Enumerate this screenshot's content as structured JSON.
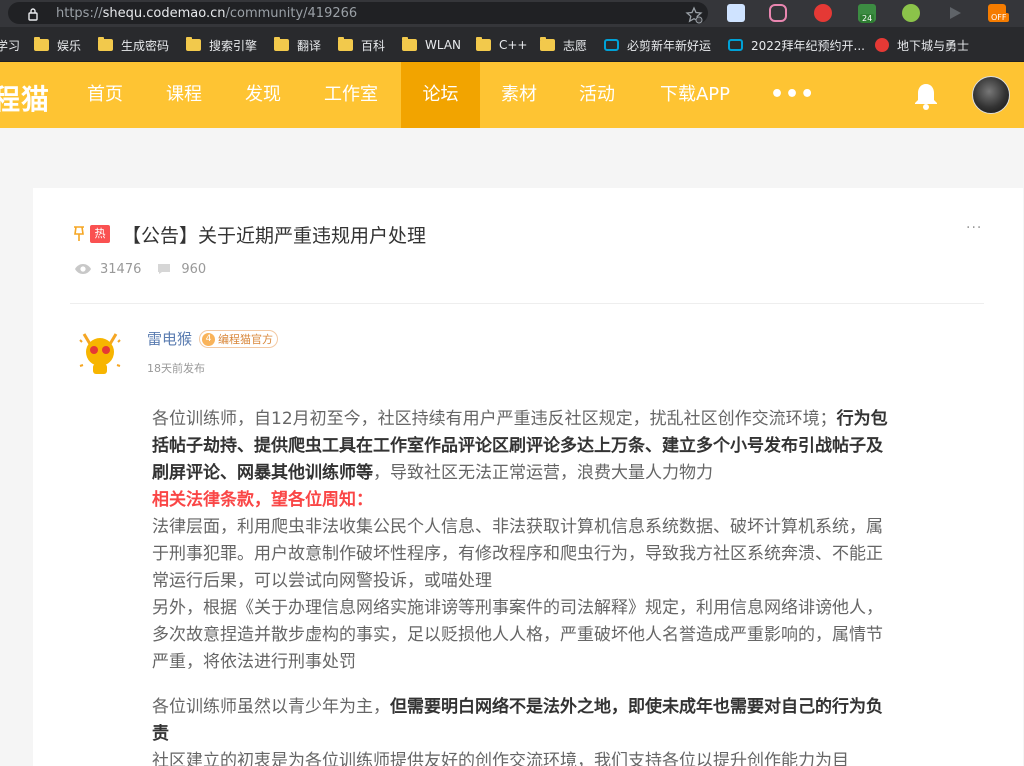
{
  "browser": {
    "url_prefix": "https://",
    "url_domain": "shequ.codemao.cn",
    "url_path": "/community/419266",
    "extension_badge": "24",
    "extension_off": "OFF"
  },
  "bookmarks": [
    {
      "label": "学习",
      "type": "folder"
    },
    {
      "label": "娱乐",
      "type": "folder"
    },
    {
      "label": "生成密码",
      "type": "folder"
    },
    {
      "label": "搜索引擎",
      "type": "folder"
    },
    {
      "label": "翻译",
      "type": "folder"
    },
    {
      "label": "百科",
      "type": "folder"
    },
    {
      "label": "WLAN",
      "type": "folder"
    },
    {
      "label": "C++",
      "type": "folder"
    },
    {
      "label": "志愿",
      "type": "folder"
    },
    {
      "label": "必剪新年新好运",
      "type": "tv"
    },
    {
      "label": "2022拜年纪预约开...",
      "type": "tv"
    },
    {
      "label": "地下城与勇士",
      "type": "game"
    }
  ],
  "nav": {
    "logo": "程猫",
    "items": [
      "首页",
      "课程",
      "发现",
      "工作室",
      "论坛",
      "素材",
      "活动",
      "下载APP"
    ],
    "active": "论坛",
    "more": "•••"
  },
  "post": {
    "hot_badge": "热",
    "title": "【公告】关于近期严重违规用户处理",
    "more": "···",
    "views": "31476",
    "comments": "960",
    "author": "雷电猴",
    "author_level": "4",
    "author_tag": "编程猫官方",
    "time": "18天前发布",
    "para1_normal": "各位训练师，自12月初至今，社区持续有用户严重违反社区规定，扰乱社区创作交流环境；",
    "para1_bold": "行为包括帖子劫持、提供爬虫工具在工作室作品评论区刷评论多达上万条、建立多个小号发布引战帖子及刷屏评论、网暴其他训练师等",
    "para1_tail": "，导致社区无法正常运营，浪费大量人力物力",
    "law_heading": "相关法律条款，望各位周知：",
    "para2": "法律层面，利用爬虫非法收集公民个人信息、非法获取计算机信息系统数据、破坏计算机系统，属于刑事犯罪。用户故意制作破坏性程序，有修改程序和爬虫行为，导致我方社区系统奔溃、不能正常运行后果，可以尝试向网警投诉，或喵处理",
    "para3": "另外，根据《关于办理信息网络实施诽谤等刑事案件的司法解释》规定，利用信息网络诽谤他人，多次故意捏造并散步虚构的事实，足以贬损他人人格，严重破坏他人名誉造成严重影响的，属情节严重，将依法进行刑事处罚",
    "para4_normal": "各位训练师虽然以青少年为主，",
    "para4_bold": "但需要明白网络不是法外之地，即使未成年也需要对自己的行为负责",
    "para5": "社区建立的初衷是为各位训练师提供友好的创作交流环境，我们支持各位以提升创作能力为目"
  },
  "colors": {
    "nav_bg": "#fec433",
    "nav_active": "#f2a400",
    "hot": "#fa5151",
    "law_red": "#fa4646",
    "author": "#5b7db1"
  }
}
